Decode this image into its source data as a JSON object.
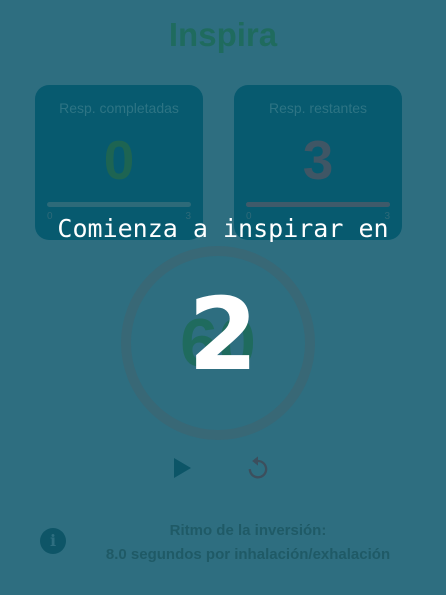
{
  "header": {
    "title": "Inspira"
  },
  "stats": {
    "completed": {
      "label": "Resp. completadas",
      "value": "0",
      "min": "0",
      "max": "3",
      "progress": 0
    },
    "remaining": {
      "label": "Resp. restantes",
      "value": "3",
      "min": "0",
      "max": "3",
      "progress": 1
    }
  },
  "timer": {
    "value": "60"
  },
  "controls": {
    "play_icon": "play-icon",
    "reset_icon": "reset-icon"
  },
  "info": {
    "icon": "info-icon",
    "line1": "Ritmo de la inversión:",
    "line2": "8.0 segundos por inhalación/exhalación"
  },
  "overlay": {
    "label": "Comienza a inspirar en",
    "countdown": "2"
  },
  "colors": {
    "background": "#2e6e80",
    "card": "#075a6f",
    "accent_green": "#1f6b5e",
    "overlay_text": "#ffffff"
  }
}
